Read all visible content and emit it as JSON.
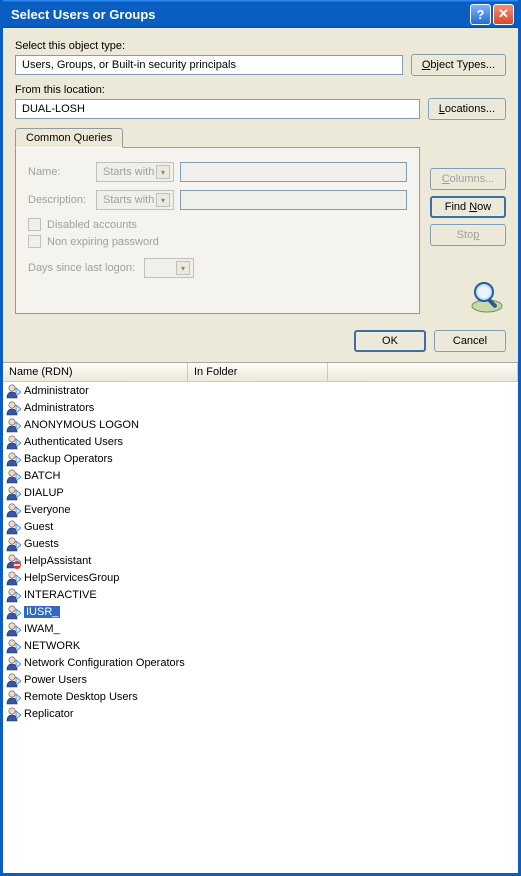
{
  "window": {
    "title": "Select Users or Groups"
  },
  "labels": {
    "object_type": "Select this object type:",
    "location": "From this location:"
  },
  "fields": {
    "object_type_value": "Users, Groups, or Built-in security principals",
    "location_value": "DUAL-LOSH"
  },
  "buttons": {
    "object_types": "Object Types...",
    "object_types_u": "O",
    "locations": "Locations...",
    "locations_u": "L",
    "columns": "Columns...",
    "columns_u": "C",
    "find_now": "Find Now",
    "find_now_u": "N",
    "stop": "Stop",
    "stop_u": "p",
    "ok": "OK",
    "cancel": "Cancel"
  },
  "tab": {
    "label": "Common Queries"
  },
  "query": {
    "name_label": "Name:",
    "desc_label": "Description:",
    "starts_with": "Starts with",
    "disabled_accounts": "Disabled accounts",
    "non_expiring": "Non expiring password",
    "days_since": "Days since last logon:"
  },
  "columns": {
    "name": "Name (RDN)",
    "folder": "In Folder"
  },
  "selected": "IUSR_",
  "results": [
    {
      "name": "Administrator",
      "denied": false
    },
    {
      "name": "Administrators",
      "denied": false
    },
    {
      "name": "ANONYMOUS LOGON",
      "denied": false
    },
    {
      "name": "Authenticated Users",
      "denied": false
    },
    {
      "name": "Backup Operators",
      "denied": false
    },
    {
      "name": "BATCH",
      "denied": false
    },
    {
      "name": "DIALUP",
      "denied": false
    },
    {
      "name": "Everyone",
      "denied": false
    },
    {
      "name": "Guest",
      "denied": false
    },
    {
      "name": "Guests",
      "denied": false
    },
    {
      "name": "HelpAssistant",
      "denied": true
    },
    {
      "name": "HelpServicesGroup",
      "denied": false
    },
    {
      "name": "INTERACTIVE",
      "denied": false
    },
    {
      "name": "IUSR_",
      "denied": false
    },
    {
      "name": "IWAM_",
      "denied": false
    },
    {
      "name": "NETWORK",
      "denied": false
    },
    {
      "name": "Network Configuration Operators",
      "denied": false
    },
    {
      "name": "Power Users",
      "denied": false
    },
    {
      "name": "Remote Desktop Users",
      "denied": false
    },
    {
      "name": "Replicator",
      "denied": false
    }
  ]
}
